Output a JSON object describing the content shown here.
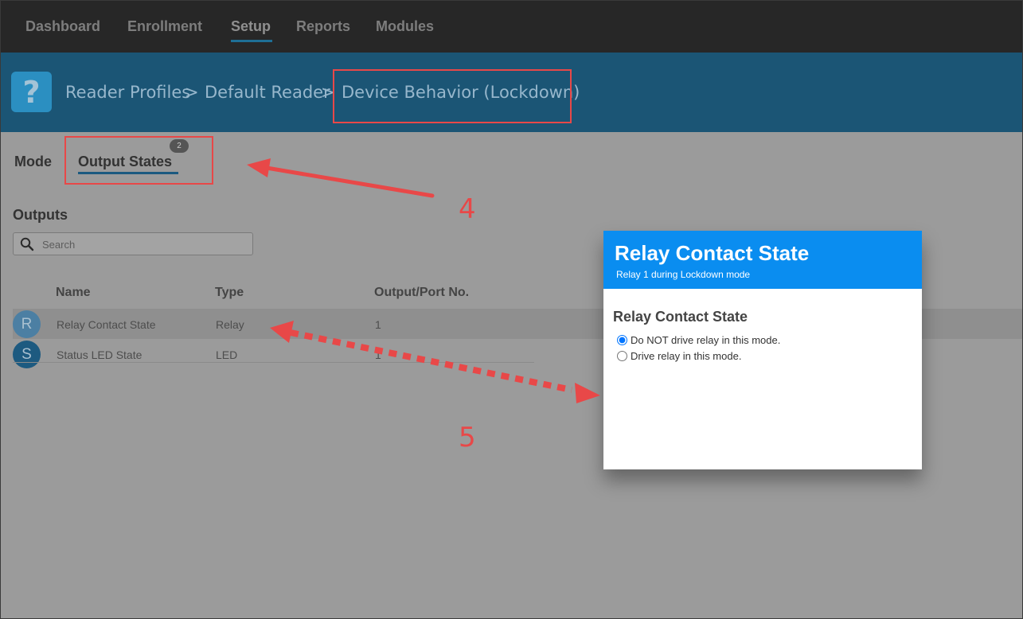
{
  "nav": {
    "items": [
      {
        "label": "Dashboard"
      },
      {
        "label": "Enrollment"
      },
      {
        "label": "Setup"
      },
      {
        "label": "Reports"
      },
      {
        "label": "Modules"
      }
    ],
    "active": "Setup"
  },
  "header": {
    "help_icon": "question-mark-icon",
    "breadcrumb": [
      "Reader Profiles",
      "Default Reader",
      "Device Behavior (Lockdown)"
    ],
    "separator": ">"
  },
  "tabs": {
    "mode": "Mode",
    "output_states": "Output States",
    "badge": "2"
  },
  "outputs": {
    "title": "Outputs",
    "search_placeholder": "Search",
    "columns": [
      "Name",
      "Type",
      "Output/Port No."
    ],
    "rows": [
      {
        "initial": "R",
        "name": "Relay Contact State",
        "type": "Relay",
        "port": "1"
      },
      {
        "initial": "S",
        "name": "Status LED State",
        "type": "LED",
        "port": "1"
      }
    ]
  },
  "modal": {
    "title": "Relay Contact State",
    "subtitle": "Relay 1 during Lockdown mode",
    "field_label": "Relay Contact State",
    "options": [
      {
        "label": "Do NOT drive relay in this mode.",
        "checked": true
      },
      {
        "label": "Drive relay in this mode.",
        "checked": false
      }
    ]
  },
  "annotations": {
    "step4": "4",
    "step5": "5",
    "color": "#e84848"
  },
  "colors": {
    "accent": "#0a8df0",
    "header_bg": "#1b5575",
    "nav_bg": "#272727"
  }
}
